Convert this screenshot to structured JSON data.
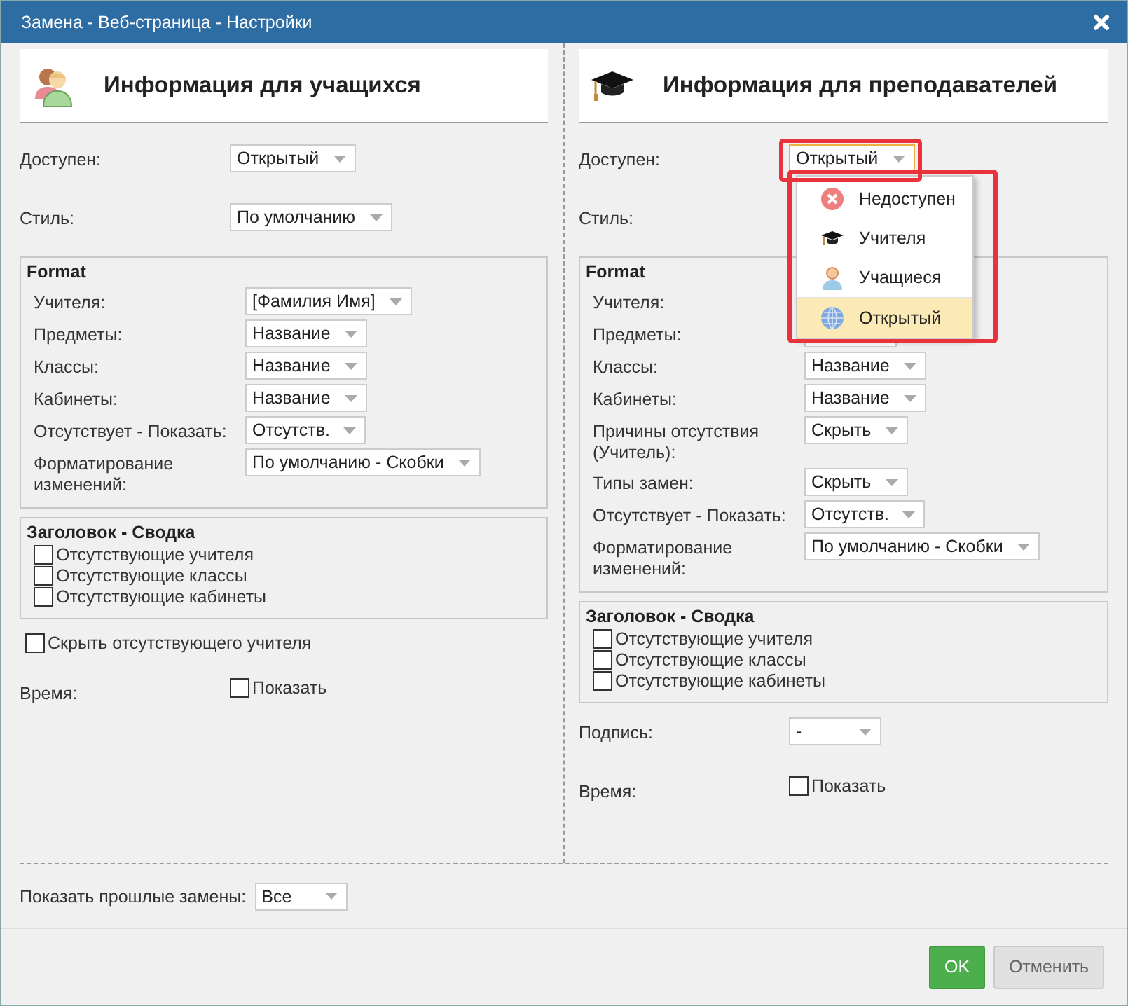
{
  "window": {
    "title": "Замена - Веб-страница - Настройки"
  },
  "columns": [
    {
      "title": "Информация для учащихся",
      "kind": "students",
      "rows": [
        {
          "kind": "select",
          "label": "Доступен:",
          "value": "Открытый",
          "open": false
        },
        {
          "kind": "select",
          "label": "Стиль:",
          "value": "По умолчанию",
          "open": false
        },
        {
          "kind": "group",
          "title": "Format",
          "rows": [
            {
              "kind": "select",
              "label": "Учителя:",
              "value": "[Фамилия Имя]"
            },
            {
              "kind": "select",
              "label": "Предметы:",
              "value": "Название"
            },
            {
              "kind": "select",
              "label": "Классы:",
              "value": "Название"
            },
            {
              "kind": "select",
              "label": "Кабинеты:",
              "value": "Название"
            },
            {
              "kind": "select",
              "label": "Отсутствует - Показать:",
              "value": "Отсутств."
            },
            {
              "kind": "select",
              "label": "Форматирование изменений:",
              "value": "По умолчанию - Скобки"
            }
          ]
        },
        {
          "kind": "group",
          "title": "Заголовок - Сводка",
          "rows": [
            {
              "kind": "checkbox",
              "label": "Отсутствующие учителя",
              "checked": false
            },
            {
              "kind": "checkbox",
              "label": "Отсутствующие классы",
              "checked": false
            },
            {
              "kind": "checkbox",
              "label": "Отсутствующие кабинеты",
              "checked": false
            }
          ]
        },
        {
          "kind": "checkbox",
          "label": "Скрыть отсутствующего учителя",
          "checked": false
        },
        {
          "kind": "checkfield",
          "label": "Время:",
          "option": "Показать",
          "checked": false
        }
      ]
    },
    {
      "title": "Информация для преподавателей",
      "kind": "teachers",
      "rows": [
        {
          "kind": "select",
          "label": "Доступен:",
          "value": "Открытый",
          "open": true,
          "options": [
            {
              "label": "Недоступен",
              "kind": "blocked",
              "selected": false
            },
            {
              "label": "Учителя",
              "kind": "teachers",
              "selected": false
            },
            {
              "label": "Учащиеся",
              "kind": "student",
              "selected": false
            },
            {
              "label": "Открытый",
              "kind": "public",
              "selected": true
            }
          ]
        },
        {
          "kind": "label",
          "label": "Стиль:"
        },
        {
          "kind": "group",
          "title": "Format",
          "rows": [
            {
              "kind": "label",
              "label": "Учителя:"
            },
            {
              "kind": "select",
              "label": "Предметы:"
            },
            {
              "kind": "select",
              "label": "Классы:",
              "value": "Название"
            },
            {
              "kind": "select",
              "label": "Кабинеты:",
              "value": "Название"
            },
            {
              "kind": "select",
              "label": "Причины отсутствия (Учитель):",
              "value": "Скрыть"
            },
            {
              "kind": "select",
              "label": "Типы замен:",
              "value": "Скрыть"
            },
            {
              "kind": "select",
              "label": "Отсутствует - Показать:",
              "value": "Отсутств."
            },
            {
              "kind": "select",
              "label": "Форматирование изменений:",
              "value": "По умолчанию - Скобки"
            }
          ]
        },
        {
          "kind": "group",
          "title": "Заголовок - Сводка",
          "rows": [
            {
              "kind": "checkbox",
              "label": "Отсутствующие учителя",
              "checked": false
            },
            {
              "kind": "checkbox",
              "label": "Отсутствующие классы",
              "checked": false
            },
            {
              "kind": "checkbox",
              "label": "Отсутствующие кабинеты",
              "checked": false
            }
          ]
        },
        {
          "kind": "select",
          "label": "Подпись:",
          "value": "-",
          "open": false
        },
        {
          "kind": "checkfield",
          "label": "Время:",
          "option": "Показать",
          "checked": false
        }
      ]
    }
  ],
  "past": {
    "label": "Показать прошлые замены:",
    "value": "Все"
  },
  "buttons": [
    {
      "label": "OK",
      "kind": "primary"
    },
    {
      "label": "Отменить",
      "kind": "secondary"
    }
  ]
}
